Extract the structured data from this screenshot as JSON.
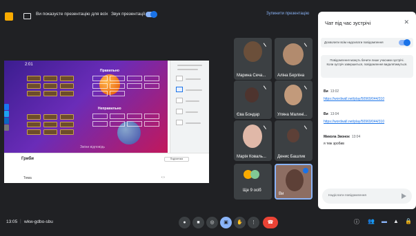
{
  "topbar": {
    "present_status": "Ви показуєте презентацію для всіх",
    "sound_label": "Звук презентації",
    "stop_label": "Зупинити презентацію"
  },
  "shared": {
    "timer": "2:01",
    "group_correct": "Правильно",
    "group_incorrect": "Неправильно",
    "footer_hint": "Зміни відповідь",
    "activity_title": "Гриби",
    "topic_label": "Тема",
    "page_arrows": "‹ ›",
    "share_button": "Поділитися"
  },
  "tiles": [
    {
      "name": "Марина Сеча..."
    },
    {
      "name": "Аліна Берліна"
    },
    {
      "name": "Єва Бондар"
    },
    {
      "name": "Уляна Малині..."
    },
    {
      "name": "Марія Коваль..."
    },
    {
      "name": "Денис Башлик"
    },
    {
      "name": "Ще 9 осіб"
    },
    {
      "name": "Ви"
    }
  ],
  "chat": {
    "title": "Чат під час зустрічі",
    "allow_label": "Дозволити всім надсилати повідомлення",
    "notice": "Повідомлення можуть бачити лише учасники зустрічі. Коли зустріч завершиться, повідомлення видалятимуться.",
    "messages": [
      {
        "sender": "Ви",
        "time": "13:02",
        "text": "https://wordwall.net/play/50969/044/310"
      },
      {
        "sender": "Ви",
        "time": "13:04",
        "text": "https://wordwall.net/play/50969/044/310"
      },
      {
        "sender": "Микола Звонок",
        "time": "13:04",
        "text": "я теж зробив"
      }
    ],
    "input_placeholder": "Надіслати повідомлення"
  },
  "bottombar": {
    "time": "13:05",
    "meeting_code": "wkw-gdbo-sbu"
  },
  "colors": {
    "accent": "#8ab4f8",
    "end_call": "#ea4335",
    "background": "#202124"
  }
}
